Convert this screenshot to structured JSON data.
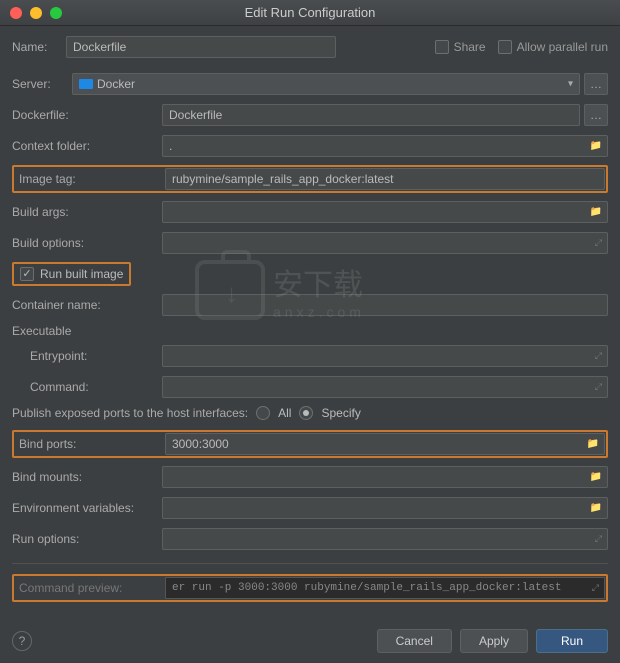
{
  "title": "Edit Run Configuration",
  "fields": {
    "name_label": "Name:",
    "name_value": "Dockerfile",
    "share_label": "Share",
    "parallel_label": "Allow parallel run",
    "server_label": "Server:",
    "server_value": "Docker",
    "dockerfile_label": "Dockerfile:",
    "dockerfile_value": "Dockerfile",
    "context_label": "Context folder:",
    "context_value": ".",
    "imagetag_label": "Image tag:",
    "imagetag_value": "rubymine/sample_rails_app_docker:latest",
    "buildargs_label": "Build args:",
    "buildopts_label": "Build options:",
    "runbuilt_label": "Run built image",
    "container_label": "Container name:",
    "executable_label": "Executable",
    "entrypoint_label": "Entrypoint:",
    "command_label": "Command:",
    "publish_label": "Publish exposed ports to the host interfaces:",
    "publish_all": "All",
    "publish_specify": "Specify",
    "bindports_label": "Bind ports:",
    "bindports_value": "3000:3000",
    "bindmounts_label": "Bind mounts:",
    "envvars_label": "Environment variables:",
    "runopts_label": "Run options:",
    "cmdpreview_label": "Command preview:",
    "cmdpreview_value": "er run -p 3000:3000 rubymine/sample_rails_app_docker:latest"
  },
  "buttons": {
    "cancel": "Cancel",
    "apply": "Apply",
    "run": "Run"
  },
  "watermark": {
    "main": "安下载",
    "sub": "anxz.com"
  }
}
